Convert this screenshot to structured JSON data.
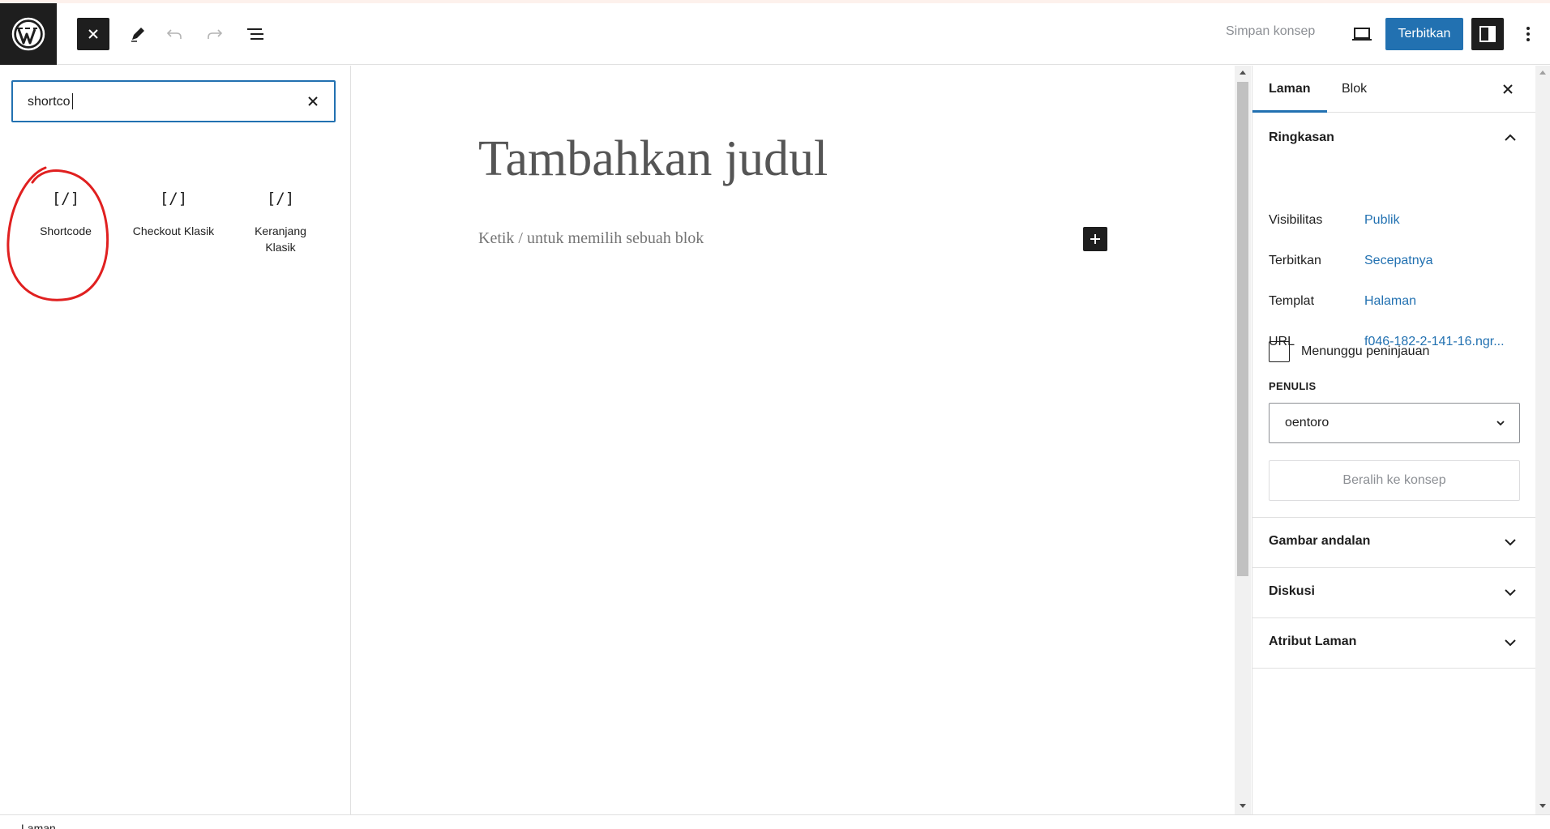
{
  "header": {
    "save_draft_label": "Simpan konsep",
    "publish_label": "Terbitkan",
    "accent_color": "#2271b1"
  },
  "icons": {
    "logo": "wordpress-logo-icon",
    "close": "close-icon",
    "edit": "pencil-icon",
    "undo": "undo-icon",
    "redo": "redo-icon",
    "outline": "list-view-icon",
    "preview": "laptop-icon",
    "settings": "sidebar-icon",
    "more": "more-vertical-icon"
  },
  "inserter": {
    "search_value": "shortco",
    "blocks": [
      {
        "icon": "[/]",
        "label": "Shortcode"
      },
      {
        "icon": "[/]",
        "label": "Checkout Klasik"
      },
      {
        "icon": "[/]",
        "label": "Keranjang Klasik"
      }
    ],
    "annotation_color": "#e02020"
  },
  "editor": {
    "title_placeholder": "Tambahkan judul",
    "block_placeholder": "Ketik / untuk memilih sebuah blok"
  },
  "sidebar": {
    "tabs": [
      {
        "label": "Laman",
        "active": true
      },
      {
        "label": "Blok",
        "active": false
      }
    ],
    "summary": {
      "title": "Ringkasan",
      "rows": [
        {
          "label": "Visibilitas",
          "value": "Publik"
        },
        {
          "label": "Terbitkan",
          "value": "Secepatnya"
        },
        {
          "label": "Templat",
          "value": "Halaman"
        },
        {
          "label": "URL",
          "value": "f046-182-2-141-16.ngr..."
        }
      ],
      "pending_review_label": "Menunggu peninjauan",
      "pending_review_checked": false,
      "author_heading": "PENULIS",
      "author_value": "oentoro",
      "switch_draft_label": "Beralih ke konsep"
    },
    "panels": [
      {
        "title": "Gambar andalan"
      },
      {
        "title": "Diskusi"
      },
      {
        "title": "Atribut Laman"
      }
    ]
  },
  "footer": {
    "breadcrumb": "Laman"
  }
}
